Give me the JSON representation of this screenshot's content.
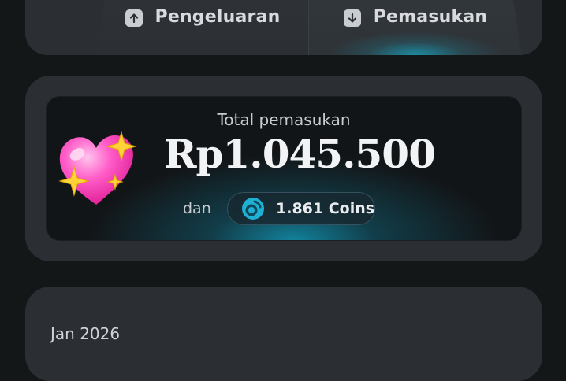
{
  "tabs": [
    {
      "label": "Pengeluaran",
      "icon": "arrow-up-icon",
      "active": false
    },
    {
      "label": "Pemasukan",
      "icon": "arrow-down-icon",
      "active": true
    }
  ],
  "summary": {
    "title": "Total pemasukan",
    "amount": "Rp1.045.500",
    "and_label": "dan",
    "coins": "1.861 Coins",
    "decoration": "sparkling-heart-icon"
  },
  "transactions": {
    "month": "Jan 2026"
  },
  "colors": {
    "background": "#141718",
    "card": "#2b2f33",
    "inner": "#121517",
    "accent": "#1aa9c8",
    "coin": "#1fb0d6"
  }
}
